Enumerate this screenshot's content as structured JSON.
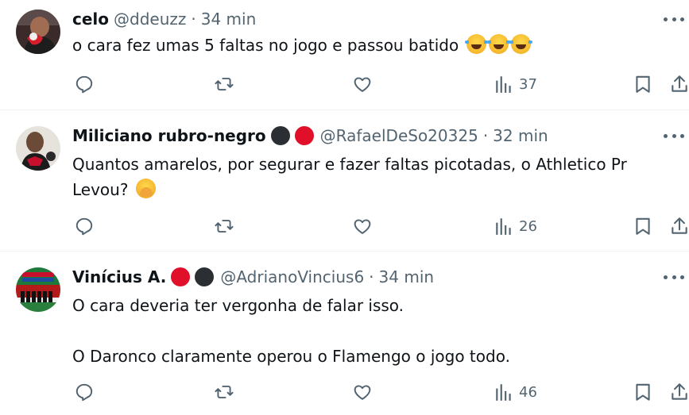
{
  "tweets": [
    {
      "name": "celo",
      "handle": "@ddeuzz",
      "time": "34 min",
      "text": "o cara fez umas 5 faltas no jogo e passou batido",
      "emojis": [
        "face-with-tears-of-joy",
        "face-with-tears-of-joy",
        "face-with-tears-of-joy"
      ],
      "badges": [],
      "views": "37"
    },
    {
      "name": "Miliciano rubro-negro",
      "handle": "@RafaelDeSo20325",
      "time": "32 min",
      "text": "Quantos amarelos, por segurar e fazer faltas picotadas, o Athletico Pr\nLevou?",
      "emojis": [
        "yawning-face"
      ],
      "badges": [
        "black",
        "red"
      ],
      "views": "26"
    },
    {
      "name": "Vinícius A.",
      "handle": "@AdrianoVincius6",
      "time": "34 min",
      "text": "O cara deveria ter vergonha de falar isso.\n\nO Daronco claramente operou o Flamengo o jogo todo.",
      "emojis": [],
      "badges": [
        "red",
        "black"
      ],
      "views": "46"
    }
  ],
  "separator": "·",
  "icons": {
    "reply": "reply-icon",
    "retweet": "retweet-icon",
    "like": "heart-icon",
    "views": "views-chart-icon",
    "bookmark": "bookmark-icon",
    "share": "share-icon",
    "more": "more-options-icon"
  },
  "colors": {
    "text": "#0f1419",
    "secondary": "#536471",
    "divider": "#eff3f4",
    "badge_red": "#e0102a",
    "badge_black": "#2b2f33"
  }
}
